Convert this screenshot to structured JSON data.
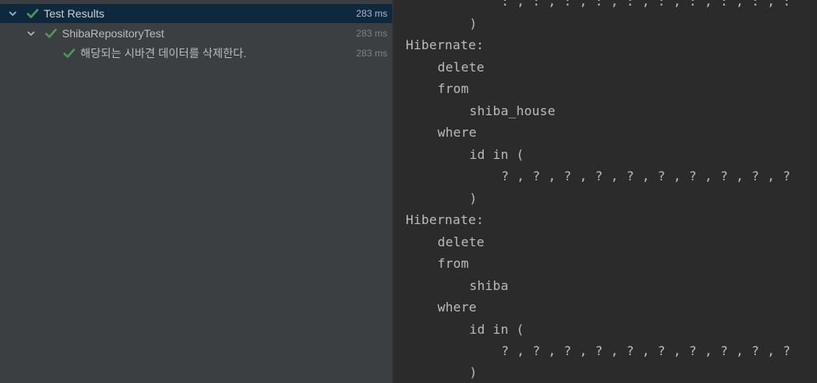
{
  "test_tree": {
    "rows": [
      {
        "label": "Test Results",
        "duration": "283 ms",
        "status": "passed",
        "expanded": true
      },
      {
        "label": "ShibaRepositoryTest",
        "duration": "283 ms",
        "status": "passed",
        "expanded": true
      },
      {
        "label": "해당되는 시바견 데이터를 삭제한다.",
        "duration": "283 ms",
        "status": "passed"
      }
    ]
  },
  "icons": {
    "expand": "chevron-down-icon",
    "passed": "check-icon"
  },
  "colors": {
    "passed_green": "#499c54",
    "selected_row": "#0d293e",
    "tree_background": "#3c3f41",
    "console_background": "#2b2b2b"
  },
  "console": {
    "lines": [
      ": , : , : , : , : , : , : , : , : , :",
      ")",
      "Hibernate:",
      "delete",
      "from",
      "shiba_house",
      "where",
      "id in (",
      "? , ? , ? , ? , ? , ? , ? , ? , ? , ?",
      ")",
      "Hibernate:",
      "delete",
      "from",
      "shiba",
      "where",
      "id in (",
      "? , ? , ? , ? , ? , ? , ? , ? , ? , ?",
      ")"
    ]
  }
}
